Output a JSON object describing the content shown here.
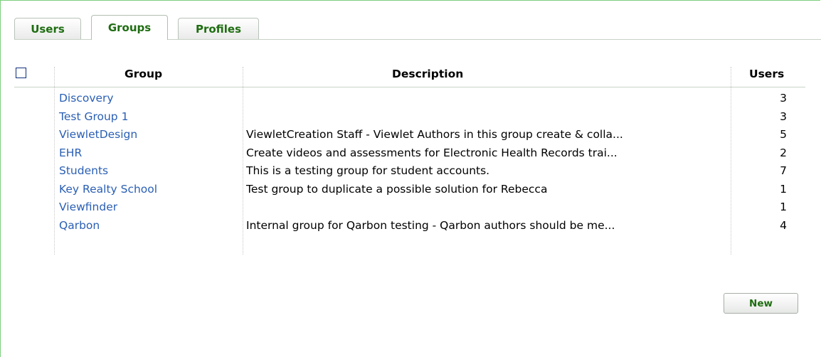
{
  "tabs": [
    {
      "label": "Users",
      "active": false
    },
    {
      "label": "Groups",
      "active": true
    },
    {
      "label": "Profiles",
      "active": false
    }
  ],
  "table": {
    "columns": {
      "group": "Group",
      "description": "Description",
      "users": "Users"
    },
    "rows": [
      {
        "group": "Discovery",
        "description": "",
        "users": "3"
      },
      {
        "group": "Test Group 1",
        "description": "",
        "users": "3"
      },
      {
        "group": "ViewletDesign",
        "description": "ViewletCreation Staff - Viewlet Authors in this group create & colla...",
        "users": "5"
      },
      {
        "group": "EHR",
        "description": "Create videos and assessments for Electronic Health Records trai...",
        "users": "2"
      },
      {
        "group": "Students",
        "description": "This is a testing group for student accounts.",
        "users": "7"
      },
      {
        "group": "Key Realty School",
        "description": "Test group to duplicate a possible solution for Rebecca",
        "users": "1"
      },
      {
        "group": "Viewfinder",
        "description": "",
        "users": "1"
      },
      {
        "group": "Qarbon",
        "description": "Internal group for Qarbon testing - Qarbon authors should be me...",
        "users": "4"
      }
    ]
  },
  "actions": {
    "new_label": "New"
  },
  "colors": {
    "tab_text": "#1f6d12",
    "link": "#2a5fb4",
    "frame": "#7ccf7c"
  }
}
